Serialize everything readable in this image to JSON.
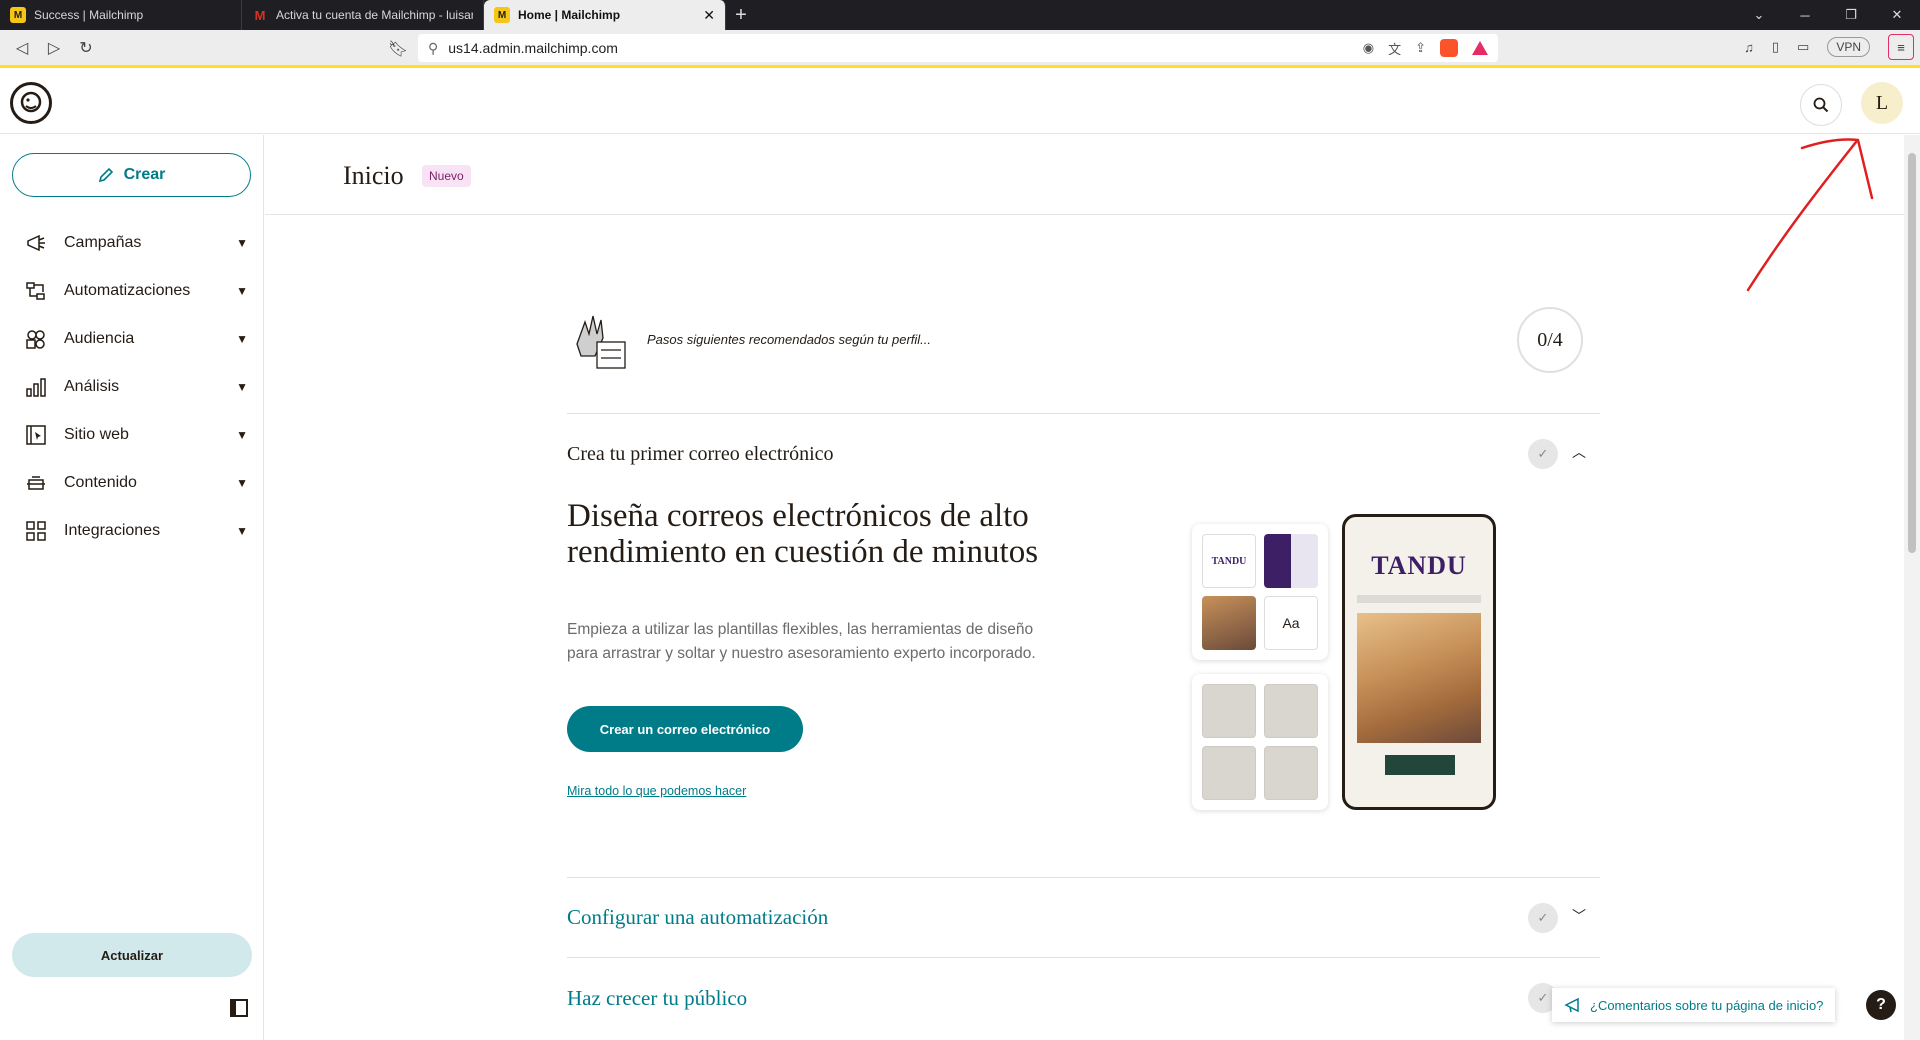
{
  "browser": {
    "tabs": [
      {
        "title": "Success | Mailchimp",
        "icon": "mailchimp-icon",
        "active": false
      },
      {
        "title": "Activa tu cuenta de Mailchimp - luisan",
        "icon": "gmail-icon",
        "active": false
      },
      {
        "title": "Home | Mailchimp",
        "icon": "mailchimp-icon",
        "active": true
      }
    ],
    "new_tab": "+",
    "url": "us14.admin.mailchimp.com",
    "vpn_label": "VPN"
  },
  "header": {
    "avatar_initial": "L"
  },
  "sidebar": {
    "create_label": "Crear",
    "items": [
      {
        "label": "Campañas",
        "icon": "megaphone-icon"
      },
      {
        "label": "Automatizaciones",
        "icon": "automation-icon"
      },
      {
        "label": "Audiencia",
        "icon": "audience-icon"
      },
      {
        "label": "Análisis",
        "icon": "bar-chart-icon"
      },
      {
        "label": "Sitio web",
        "icon": "website-icon"
      },
      {
        "label": "Contenido",
        "icon": "content-icon"
      },
      {
        "label": "Integraciones",
        "icon": "grid-icon"
      }
    ],
    "upgrade_label": "Actualizar"
  },
  "page": {
    "title": "Inicio",
    "badge": "Nuevo"
  },
  "steps": {
    "text": "Pasos siguientes recomendados según tu perfil...",
    "progress": "0/4",
    "first_section": {
      "title": "Crea tu primer correo electrónico",
      "hero_title": "Diseña correos electrónicos de alto rendimiento en cuestión de minutos",
      "hero_desc": "Empieza a utilizar las plantillas flexibles, las herramientas de diseño para arrastrar y soltar y nuestro asesoramiento experto incorporado.",
      "cta": "Crear un correo electrónico",
      "link": "Mira todo lo que podemos hacer",
      "illustration": {
        "brand_small": "TANDU",
        "font_tile": "Aa",
        "brand_large": "TANDU"
      }
    },
    "sections": [
      {
        "title": "Configurar una automatización"
      },
      {
        "title": "Haz crecer tu público"
      }
    ]
  },
  "feedback_label": "¿Comentarios sobre tu página de inicio?",
  "help_label": "?",
  "colors": {
    "accent": "#007c89",
    "brand_yellow": "#ffe01b",
    "annotation": "#e02020"
  }
}
